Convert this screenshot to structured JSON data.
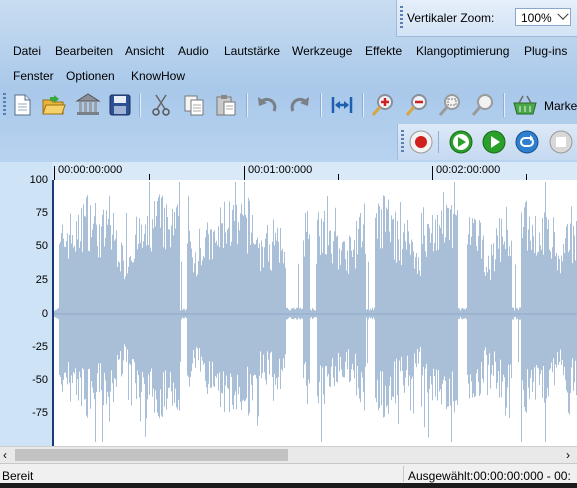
{
  "zoom": {
    "label": "Vertikaler Zoom:",
    "value": "100%"
  },
  "menu_row1": [
    "Datei",
    "Bearbeiten",
    "Ansicht",
    "Audio",
    "Lautstärke",
    "Werkzeuge",
    "Effekte",
    "Klangoptimierung",
    "Plug-ins"
  ],
  "menu_row2": [
    "Fenster",
    "Optionen",
    "KnowHow"
  ],
  "toolbar": {
    "market_label": "Market"
  },
  "ruler": {
    "ticks": [
      "00:00:00:000",
      "00:01:00:000",
      "00:02:00:000"
    ]
  },
  "yaxis": {
    "labels": [
      "100",
      "75",
      "50",
      "25",
      "0",
      "-25",
      "-50",
      "-75"
    ]
  },
  "status": {
    "left": "Bereit",
    "right": "Ausgewählt:00:00:00:000 - 00:"
  },
  "colors": {
    "waveform": "#a9bfd8",
    "chrome": "#b8d3ef",
    "record": "#d02020",
    "play": "#2aa02a",
    "loop": "#2f7fd0"
  }
}
